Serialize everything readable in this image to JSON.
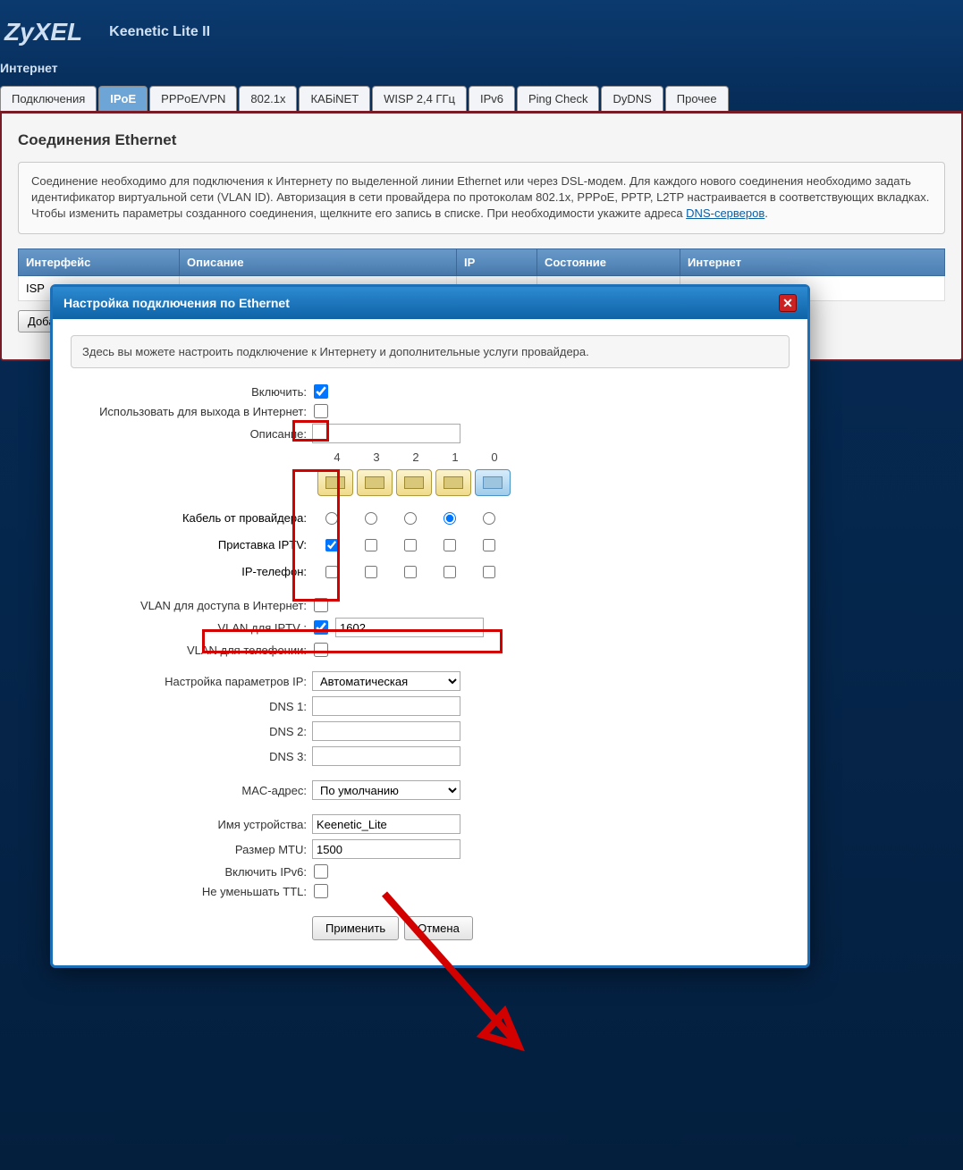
{
  "header": {
    "logo": "ZyXEL",
    "product": "Keenetic Lite II",
    "section": "Интернет"
  },
  "tabs": [
    {
      "label": "Подключения",
      "active": false
    },
    {
      "label": "IPoE",
      "active": true
    },
    {
      "label": "PPPoE/VPN",
      "active": false
    },
    {
      "label": "802.1x",
      "active": false
    },
    {
      "label": "КАБiNET",
      "active": false
    },
    {
      "label": "WISP 2,4 ГГц",
      "active": false
    },
    {
      "label": "IPv6",
      "active": false
    },
    {
      "label": "Ping Check",
      "active": false
    },
    {
      "label": "DyDNS",
      "active": false
    },
    {
      "label": "Прочее",
      "active": false
    }
  ],
  "panel": {
    "title": "Соединения Ethernet",
    "info_pre": "Соединение необходимо для подключения к Интернету по выделенной линии Ethernet или через DSL-модем. Для каждого нового соединения необходимо задать идентификатор виртуальной сети (VLAN ID). Авторизация в сети провайдера по протоколам 802.1x, PPPoE, PPTP, L2TP настраивается в соответствующих вкладках. Чтобы изменить параметры созданного соединения, щелкните его запись в списке. При необходимости укажите адреса ",
    "dns_link": "DNS-серверов",
    "info_post": ".",
    "columns": {
      "c1": "Интерфейс",
      "c2": "Описание",
      "c3": "IP",
      "c4": "Состояние",
      "c5": "Интернет"
    },
    "row1": {
      "c1": "ISP"
    },
    "add_button": "Добавить"
  },
  "modal": {
    "title": "Настройка подключения по Ethernet",
    "info": "Здесь вы можете настроить подключение к Интернету и дополнительные услуги провайдера.",
    "labels": {
      "enable": "Включить:",
      "use_for_internet": "Использовать для выхода в Интернет:",
      "description": "Описание:",
      "cable": "Кабель от провайдера:",
      "iptv_box": "Приставка IPTV:",
      "ipphone": "IP-телефон:",
      "vlan_internet": "VLAN для доступа в Интернет:",
      "vlan_iptv": "VLAN для IPTV :",
      "vlan_tel": "VLAN для телефонии:",
      "ip_params": "Настройка параметров IP:",
      "dns1": "DNS 1:",
      "dns2": "DNS 2:",
      "dns3": "DNS 3:",
      "mac": "MAC-адрес:",
      "device_name": "Имя устройства:",
      "mtu": "Размер MTU:",
      "ipv6": "Включить IPv6:",
      "ttl": "Не уменьшать TTL:"
    },
    "ports": [
      "4",
      "3",
      "2",
      "1",
      "0"
    ],
    "values": {
      "enable": true,
      "use_for_internet": false,
      "description": "",
      "cable_selected": 3,
      "iptv_checked": [
        true,
        false,
        false,
        false,
        false
      ],
      "ipphone_checked": [
        false,
        false,
        false,
        false,
        false
      ],
      "vlan_internet_enabled": false,
      "vlan_iptv_enabled": true,
      "vlan_iptv_value": "1602",
      "vlan_tel_enabled": false,
      "ip_params": "Автоматическая",
      "dns1": "",
      "dns2": "",
      "dns3": "",
      "mac": "По умолчанию",
      "device_name": "Keenetic_Lite",
      "mtu": "1500",
      "ipv6": false,
      "ttl": false
    },
    "buttons": {
      "apply": "Применить",
      "cancel": "Отмена"
    }
  }
}
